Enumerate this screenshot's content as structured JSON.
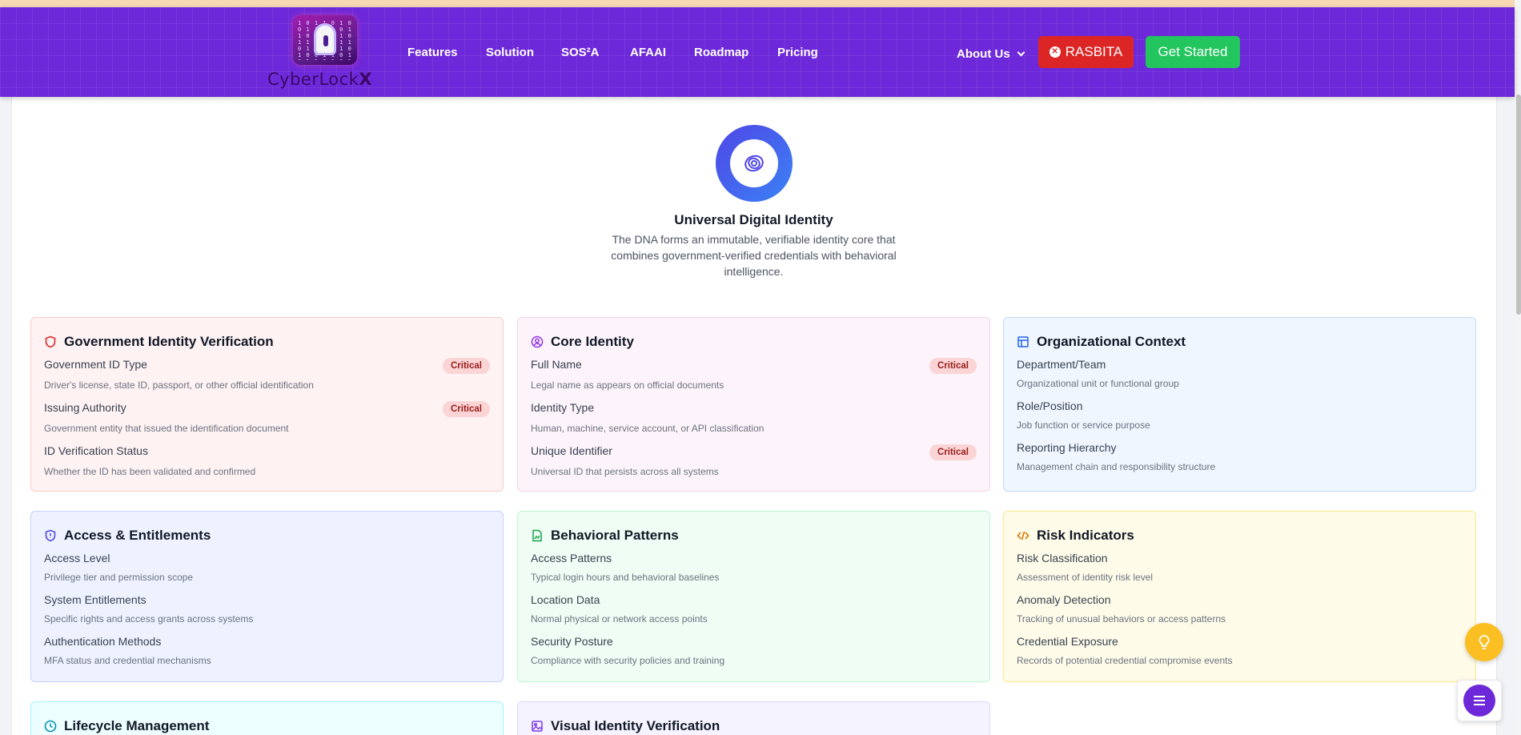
{
  "brand": {
    "name": "CyberLockX",
    "name_prefix": "CyberLock",
    "name_suffix": "X"
  },
  "nav": {
    "links": [
      {
        "label": "Features"
      },
      {
        "label": "Solution"
      },
      {
        "label": "SOS²A"
      },
      {
        "label": "AFAAI"
      },
      {
        "label": "Roadmap"
      },
      {
        "label": "Pricing"
      }
    ],
    "about_label": "About Us",
    "rasbita_label": "RASBITA",
    "get_started_label": "Get Started"
  },
  "hero": {
    "title": "Universal Digital Identity",
    "description": "The DNA forms an immutable, verifiable identity core that combines government-verified credentials with behavioral intelligence."
  },
  "cards": [
    {
      "title": "Government Identity Verification",
      "icon": "shield-icon",
      "fields": [
        {
          "label": "Government ID Type",
          "desc": "Driver's license, state ID, passport, or other official identification",
          "badge": "Critical"
        },
        {
          "label": "Issuing Authority",
          "desc": "Government entity that issued the identification document",
          "badge": "Critical"
        },
        {
          "label": "ID Verification Status",
          "desc": "Whether the ID has been validated and confirmed",
          "badge": ""
        }
      ]
    },
    {
      "title": "Core Identity",
      "icon": "user-circle-icon",
      "fields": [
        {
          "label": "Full Name",
          "desc": "Legal name as appears on official documents",
          "badge": "Critical"
        },
        {
          "label": "Identity Type",
          "desc": "Human, machine, service account, or API classification",
          "badge": ""
        },
        {
          "label": "Unique Identifier",
          "desc": "Universal ID that persists across all systems",
          "badge": "Critical"
        }
      ]
    },
    {
      "title": "Organizational Context",
      "icon": "layout-icon",
      "fields": [
        {
          "label": "Department/Team",
          "desc": "Organizational unit or functional group",
          "badge": ""
        },
        {
          "label": "Role/Position",
          "desc": "Job function or service purpose",
          "badge": ""
        },
        {
          "label": "Reporting Hierarchy",
          "desc": "Management chain and responsibility structure",
          "badge": ""
        }
      ]
    },
    {
      "title": "Access & Entitlements",
      "icon": "shield-alert-icon",
      "fields": [
        {
          "label": "Access Level",
          "desc": "Privilege tier and permission scope",
          "badge": ""
        },
        {
          "label": "System Entitlements",
          "desc": "Specific rights and access grants across systems",
          "badge": ""
        },
        {
          "label": "Authentication Methods",
          "desc": "MFA status and credential mechanisms",
          "badge": ""
        }
      ]
    },
    {
      "title": "Behavioral Patterns",
      "icon": "file-chart-icon",
      "fields": [
        {
          "label": "Access Patterns",
          "desc": "Typical login hours and behavioral baselines",
          "badge": ""
        },
        {
          "label": "Location Data",
          "desc": "Normal physical or network access points",
          "badge": ""
        },
        {
          "label": "Security Posture",
          "desc": "Compliance with security policies and training",
          "badge": ""
        }
      ]
    },
    {
      "title": "Risk Indicators",
      "icon": "code-icon",
      "fields": [
        {
          "label": "Risk Classification",
          "desc": "Assessment of identity risk level",
          "badge": ""
        },
        {
          "label": "Anomaly Detection",
          "desc": "Tracking of unusual behaviors or access patterns",
          "badge": ""
        },
        {
          "label": "Credential Exposure",
          "desc": "Records of potential credential compromise events",
          "badge": ""
        }
      ]
    },
    {
      "title": "Lifecycle Management",
      "icon": "clock-icon",
      "fields": []
    },
    {
      "title": "Visual Identity Verification",
      "icon": "image-icon",
      "fields": []
    }
  ],
  "colors": {
    "nav_bg": "#6d28d9",
    "rasbita": "#dc2626",
    "get_started": "#22c55e",
    "critical_badge_bg": "#fbd5d5",
    "critical_badge_text": "#991b1b"
  }
}
